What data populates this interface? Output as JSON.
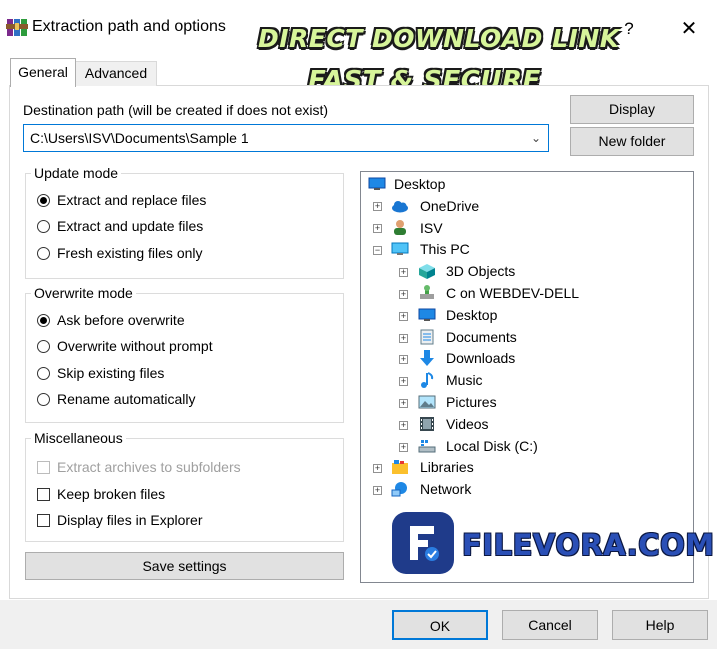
{
  "window": {
    "title": "Extraction path and options",
    "help_glyph": "?",
    "close_glyph": "✕"
  },
  "watermark": {
    "line1": "DIRECT DOWNLOAD LINK",
    "line2": "FAST & SECURE"
  },
  "tabs": [
    {
      "label": "General",
      "active": true
    },
    {
      "label": "Advanced",
      "active": false
    }
  ],
  "destination": {
    "label": "Destination path (will be created if does not exist)",
    "value": "C:\\Users\\ISV\\Documents\\Sample 1"
  },
  "buttons": {
    "display": "Display",
    "new_folder": "New folder",
    "save_settings": "Save settings",
    "ok": "OK",
    "cancel": "Cancel",
    "help": "Help"
  },
  "update_mode": {
    "label": "Update mode",
    "options": [
      {
        "label": "Extract and replace files",
        "checked": true
      },
      {
        "label": "Extract and update files",
        "checked": false
      },
      {
        "label": "Fresh existing files only",
        "checked": false
      }
    ]
  },
  "overwrite_mode": {
    "label": "Overwrite mode",
    "options": [
      {
        "label": "Ask before overwrite",
        "checked": true
      },
      {
        "label": "Overwrite without prompt",
        "checked": false
      },
      {
        "label": "Skip existing files",
        "checked": false
      },
      {
        "label": "Rename automatically",
        "checked": false
      }
    ]
  },
  "miscellaneous": {
    "label": "Miscellaneous",
    "options": [
      {
        "label": "Extract archives to subfolders",
        "checked": false,
        "disabled": true
      },
      {
        "label": "Keep broken files",
        "checked": false,
        "disabled": false
      },
      {
        "label": "Display files in Explorer",
        "checked": false,
        "disabled": false
      }
    ]
  },
  "tree": {
    "nodes": [
      {
        "label": "Desktop",
        "icon": "desktop-icon"
      },
      {
        "label": "OneDrive",
        "icon": "cloud-icon"
      },
      {
        "label": "ISV",
        "icon": "user-icon"
      },
      {
        "label": "This PC",
        "icon": "computer-icon"
      },
      {
        "label": "3D Objects",
        "icon": "cube-icon"
      },
      {
        "label": "C on WEBDEV-DELL",
        "icon": "network-drive-icon"
      },
      {
        "label": "Desktop",
        "icon": "desktop-icon"
      },
      {
        "label": "Documents",
        "icon": "document-icon"
      },
      {
        "label": "Downloads",
        "icon": "download-arrow-icon"
      },
      {
        "label": "Music",
        "icon": "music-note-icon"
      },
      {
        "label": "Pictures",
        "icon": "picture-icon"
      },
      {
        "label": "Videos",
        "icon": "film-icon"
      },
      {
        "label": "Local Disk (C:)",
        "icon": "disk-icon"
      },
      {
        "label": "Libraries",
        "icon": "library-icon"
      },
      {
        "label": "Network",
        "icon": "network-icon"
      }
    ]
  },
  "brand": {
    "text": "FILEVORA.COM",
    "logo_letter": "F"
  },
  "colors": {
    "accent": "#0078d7",
    "watermark_fill": "#d7f59a",
    "brand_blue": "#2a4fb6"
  }
}
